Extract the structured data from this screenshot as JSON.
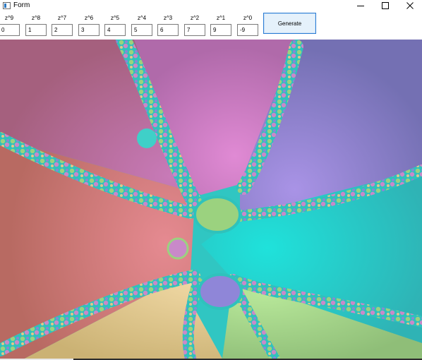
{
  "window": {
    "title": "Form"
  },
  "coefficients": [
    {
      "label": "z^9",
      "value": "0"
    },
    {
      "label": "z^8",
      "value": "1"
    },
    {
      "label": "z^7",
      "value": "2"
    },
    {
      "label": "z^6",
      "value": "3"
    },
    {
      "label": "z^5",
      "value": "4"
    },
    {
      "label": "z^4",
      "value": "5"
    },
    {
      "label": "z^3",
      "value": "6"
    },
    {
      "label": "z^2",
      "value": "7"
    },
    {
      "label": "z^1",
      "value": "9"
    },
    {
      "label": "z^0",
      "value": "-9"
    }
  ],
  "toolbar": {
    "generate_label": "Generate"
  },
  "colors": {
    "accent": "#2b7cd3",
    "basin_magenta": "#c270b8",
    "basin_purple": "#8a7cc4",
    "basin_cyan": "#25cfc9",
    "basin_red": "#c96f72",
    "basin_yellow": "#d8c58a",
    "basin_green": "#98d088"
  },
  "icons": {
    "app": "form-icon",
    "minimize": "minimize-icon",
    "maximize": "maximize-icon",
    "close": "close-icon"
  }
}
